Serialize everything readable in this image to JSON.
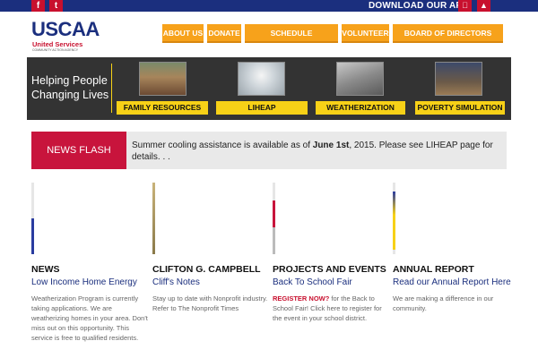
{
  "topbar": {
    "social_icons": [
      "facebook-icon",
      "twitter-icon"
    ],
    "download_app_label": "DOWNLOAD OUR APP",
    "app_icons": [
      "apple-icon",
      "android-icon"
    ]
  },
  "logo": {
    "title": "USCAA",
    "subtitle": "United Services",
    "subtitle2": "COMMUNITY ACTION AGENCY"
  },
  "nav": {
    "items": [
      {
        "label": "ABOUT US"
      },
      {
        "label": "DONATE"
      },
      {
        "label": "SCHEDULE APPOINTMENT"
      },
      {
        "label": "VOLUNTEER"
      },
      {
        "label": "BOARD OF DIRECTORS LOGIN"
      }
    ]
  },
  "banner": {
    "tagline_line1": "Helping People",
    "tagline_line2": "Changing Lives",
    "programs": [
      {
        "label": "FAMILY RESOURCES",
        "icon": "family-photo-icon"
      },
      {
        "label": "LIHEAP",
        "icon": "lightbulb-photo-icon"
      },
      {
        "label": "WEATHERIZATION",
        "icon": "worker-photo-icon"
      },
      {
        "label": "POVERTY SIMULATION",
        "icon": "feet-photo-icon"
      }
    ]
  },
  "newsflash": {
    "label": "NEWS FLASH",
    "text_before": "Summer cooling assistance is available as of ",
    "text_bold": "June 1st",
    "text_after": ", 2015. Please see LIHEAP page for details. . ."
  },
  "columns": [
    {
      "heading": "NEWS",
      "subheading": "Low Income Home Energy",
      "body": "Weatherization Program is currently taking applications. We are weatherizing homes in your area. Don't miss out on this opportunity. This service is free to qualified residents."
    },
    {
      "heading": "CLIFTON G. CAMPBELL",
      "subheading": "Cliff's Notes",
      "body": "Stay up to date with Nonprofit industry. Refer to The Nonprofit Times"
    },
    {
      "heading": "PROJECTS AND EVENTS",
      "subheading": "Back To School Fair",
      "body_red": "REGISTER NOW?",
      "body": " for the Back to School Fair!  Click here to register for the event in your school district."
    },
    {
      "heading": "ANNUAL REPORT",
      "subheading": "Read our Annual Report Here",
      "body": "We are making a difference in our community."
    }
  ],
  "colors": {
    "navy": "#1b2f7e",
    "red": "#c8102e",
    "orange": "#f7a21b",
    "yellow": "#f7d117",
    "banner_bg": "#333333"
  }
}
